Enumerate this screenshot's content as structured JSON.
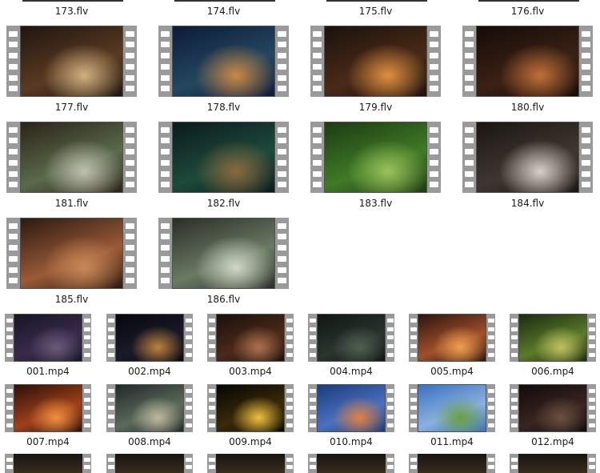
{
  "top_labels": [
    "173.flv",
    "174.flv",
    "175.flv",
    "176.flv"
  ],
  "flv_items": [
    {
      "name": "177.flv",
      "colors": [
        "#1f150f",
        "#5a3a22",
        "#d0b080"
      ]
    },
    {
      "name": "178.flv",
      "colors": [
        "#0b1a3a",
        "#24475f",
        "#c98845"
      ]
    },
    {
      "name": "179.flv",
      "colors": [
        "#1a120c",
        "#4a2a18",
        "#e09040"
      ]
    },
    {
      "name": "180.flv",
      "colors": [
        "#140b07",
        "#3a2115",
        "#c07038"
      ]
    },
    {
      "name": "181.flv",
      "colors": [
        "#2a2218",
        "#5a6a4a",
        "#c0c0b0"
      ]
    },
    {
      "name": "182.flv",
      "colors": [
        "#0a1a1c",
        "#1d4a3a",
        "#8a6a40"
      ]
    },
    {
      "name": "183.flv",
      "colors": [
        "#1c3a12",
        "#3f7a26",
        "#9ac25a"
      ]
    },
    {
      "name": "184.flv",
      "colors": [
        "#1a1512",
        "#3f3630",
        "#d8d0c8"
      ]
    },
    {
      "name": "185.flv",
      "colors": [
        "#2a1810",
        "#9a5a38",
        "#c88858"
      ]
    },
    {
      "name": "186.flv",
      "colors": [
        "#2a2c28",
        "#6a7a62",
        "#d0d8c8"
      ]
    }
  ],
  "mp4_items": [
    {
      "name": "001.mp4",
      "colors": [
        "#151525",
        "#3a2a4a",
        "#6a5a7a"
      ]
    },
    {
      "name": "002.mp4",
      "colors": [
        "#07070d",
        "#1a1a2a",
        "#c08040"
      ]
    },
    {
      "name": "003.mp4",
      "colors": [
        "#1a0f0a",
        "#4a2a1a",
        "#b07050"
      ]
    },
    {
      "name": "004.mp4",
      "colors": [
        "#101512",
        "#2a3530",
        "#50604f"
      ]
    },
    {
      "name": "005.mp4",
      "colors": [
        "#2a1410",
        "#a0502a",
        "#f0a050"
      ]
    },
    {
      "name": "006.mp4",
      "colors": [
        "#1a2a10",
        "#5a7a2a",
        "#c0c060"
      ]
    },
    {
      "name": "007.mp4",
      "colors": [
        "#2a0f08",
        "#a0401a",
        "#f09040"
      ]
    },
    {
      "name": "008.mp4",
      "colors": [
        "#202828",
        "#5a6a5a",
        "#c0b8a0"
      ]
    },
    {
      "name": "009.mp4",
      "colors": [
        "#050505",
        "#3a2a08",
        "#f0c040"
      ]
    },
    {
      "name": "010.mp4",
      "colors": [
        "#1a3a7a",
        "#4a70c0",
        "#e08040"
      ]
    },
    {
      "name": "011.mp4",
      "colors": [
        "#3a70c0",
        "#8ab0e0",
        "#6aa040"
      ]
    },
    {
      "name": "012.mp4",
      "colors": [
        "#0f0a0a",
        "#3a2520",
        "#6a5040"
      ]
    }
  ],
  "bottom_stub_count": 6,
  "icons": {
    "video_file": "film-strip-icon"
  }
}
